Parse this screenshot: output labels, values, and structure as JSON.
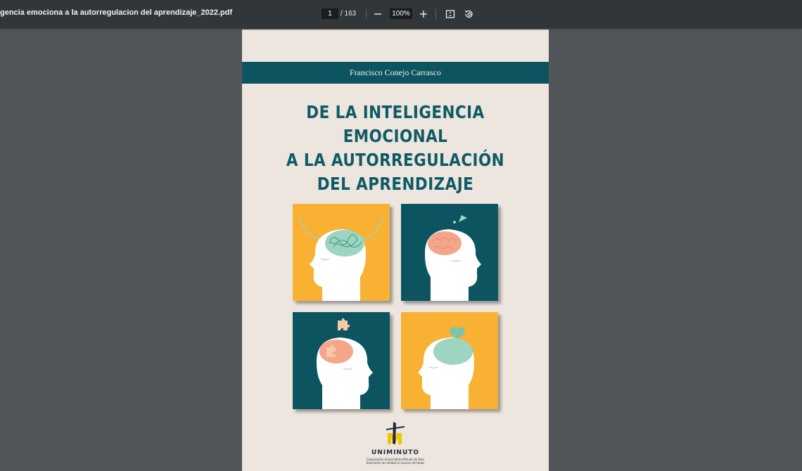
{
  "toolbar": {
    "title": "gencia emociona a la autorregulacion del aprendizaje_2022.pdf",
    "page_current": "1",
    "page_total": "/ 163",
    "zoom": "100%",
    "zoom_out_icon": "minus-icon",
    "zoom_in_icon": "plus-icon",
    "fit_icon": "fit-page-icon",
    "rotate_icon": "rotate-icon"
  },
  "cover": {
    "author": "Francisco Conejo Carrasco",
    "title_lines": [
      "DE LA INTELIGENCIA",
      "EMOCIONAL",
      "A LA AUTORREGULACIÓN",
      "DEL APRENDIZAJE"
    ],
    "colors": {
      "teal": "#0c5560",
      "yellow": "#f8b133",
      "cream": "#ede6de",
      "brain_green": "#9ed4c2",
      "brain_orange": "#f4a58a"
    },
    "publisher": {
      "name": "UNIMINUTO",
      "line1": "Corporación Universitaria Minuto de Dios",
      "line2": "Educación de calidad al alcance de todos"
    }
  }
}
